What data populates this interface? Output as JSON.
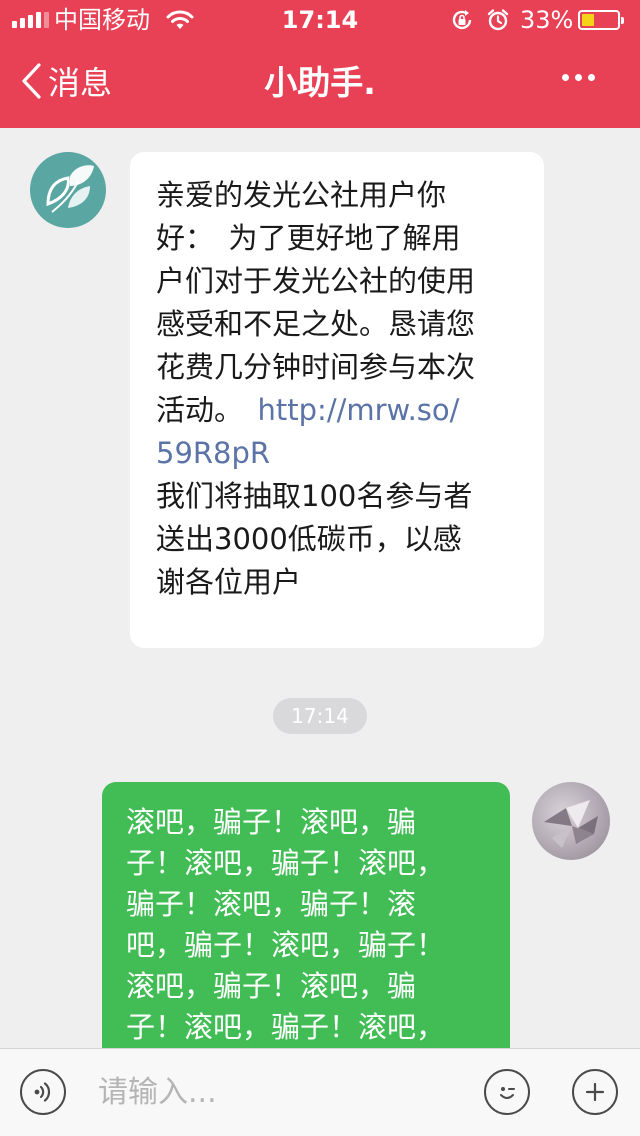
{
  "status_bar": {
    "carrier": "中国移动",
    "time": "17:14",
    "battery_percent": "33%",
    "battery_level": 0.33,
    "icons": [
      "signal-icon",
      "wifi-icon",
      "rotation-lock-icon",
      "alarm-icon",
      "battery-icon"
    ]
  },
  "nav": {
    "back_label": "消息",
    "title": "小助手.",
    "more_icon": "more-icon"
  },
  "messages": {
    "incoming": {
      "lines_before": [
        "亲爱的发光公社用户你",
        "好：　为了更好地了解用",
        "户们对于发光公社的使用",
        "感受和不足之处。恳请您",
        "花费几分钟时间参与本次"
      ],
      "prefix": "活动。　",
      "link_part1": "http://mrw.so/",
      "link_part2": "59R8pR",
      "lines_after": [
        "我们将抽取100名参与者",
        "送出3000低碳币，以感",
        "谢各位用户"
      ]
    },
    "timestamp": "17:14",
    "outgoing": {
      "lines": [
        "滚吧，骗子！滚吧，骗",
        "子！滚吧，骗子！滚吧，",
        "骗子！滚吧，骗子！滚",
        "吧，骗子！滚吧，骗子！",
        "滚吧，骗子！滚吧，骗",
        "子！滚吧，骗子！滚吧，"
      ]
    }
  },
  "input_bar": {
    "placeholder": "请输入...",
    "icons": [
      "voice-icon",
      "emoji-icon",
      "plus-icon"
    ]
  },
  "colors": {
    "header_bg": "#e84155",
    "outgoing_bubble": "#42bd56",
    "incoming_bubble": "#ffffff",
    "link": "#5b73a6",
    "chat_bg": "#efeff0"
  }
}
